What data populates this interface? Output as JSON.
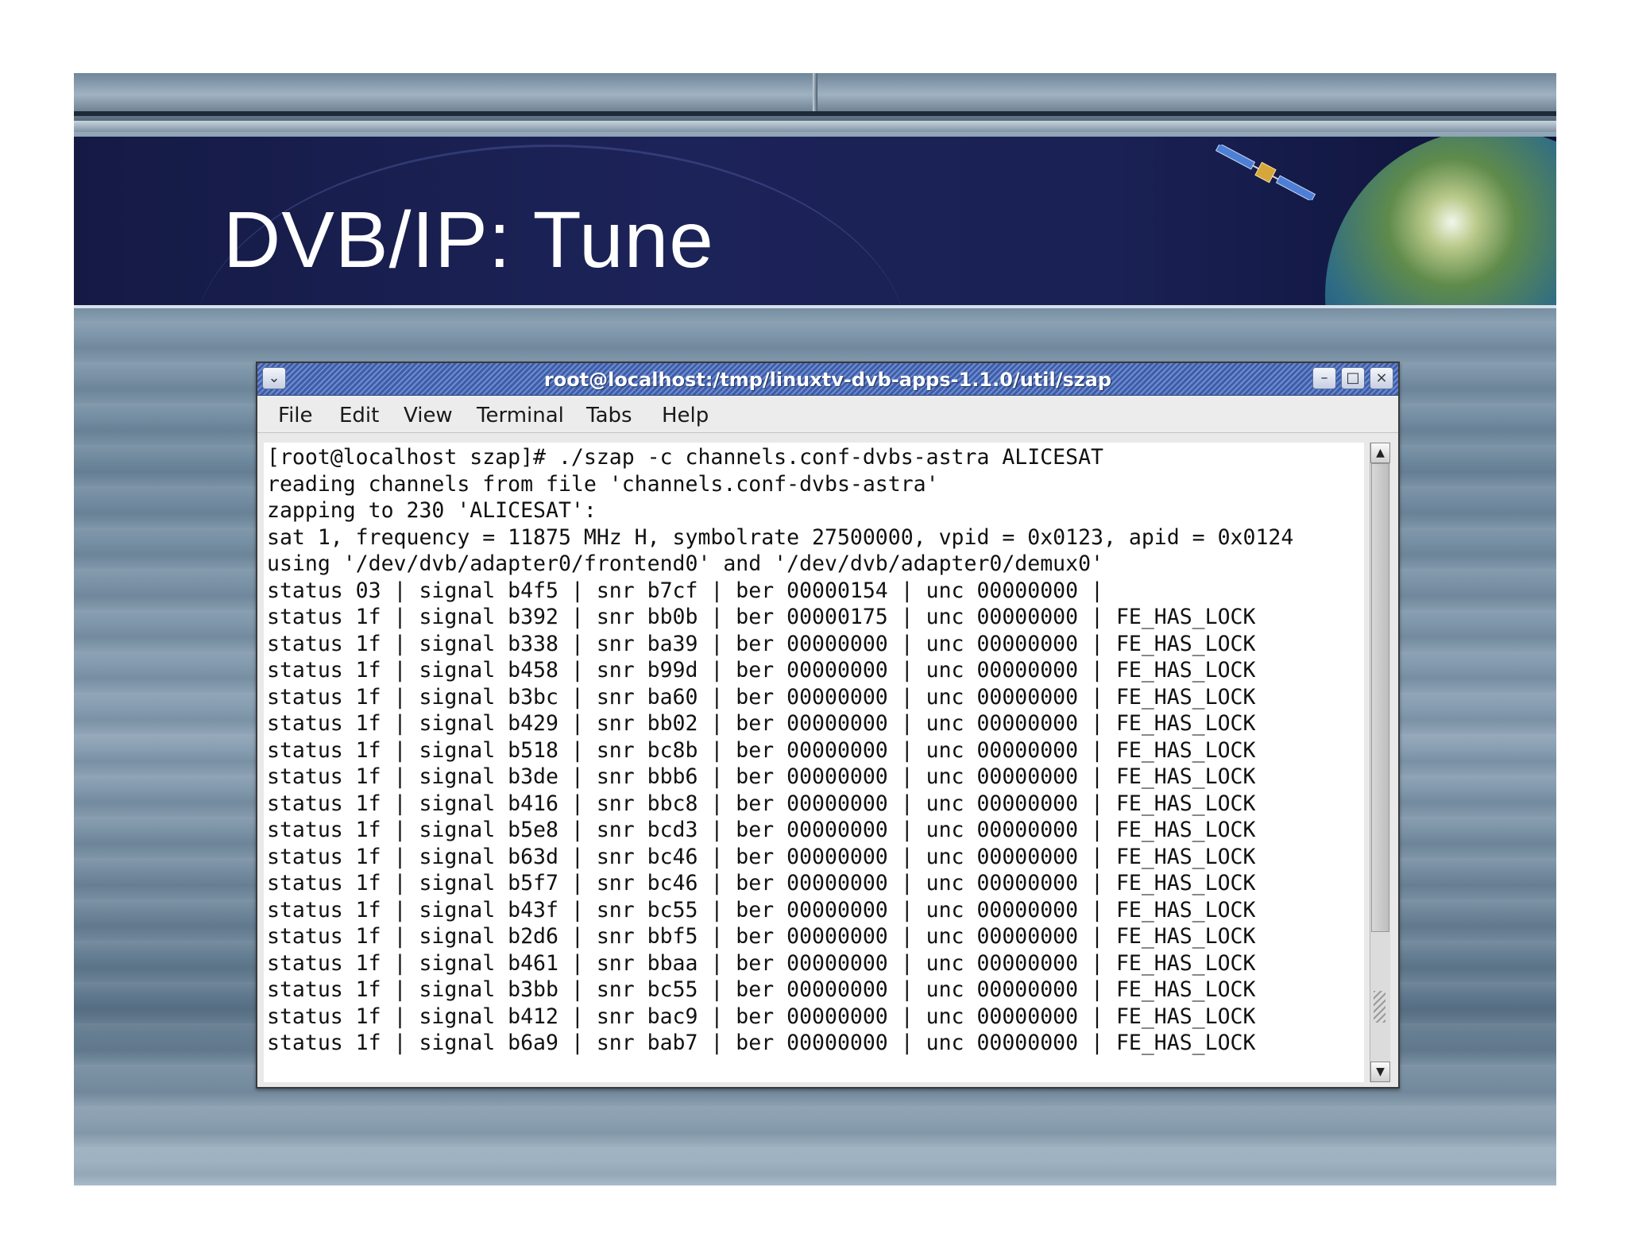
{
  "slide": {
    "title": "DVB/IP: Tune"
  },
  "window": {
    "title": "root@localhost:/tmp/linuxtv-dvb-apps-1.1.0/util/szap",
    "menu": [
      {
        "label": "File"
      },
      {
        "label": "Edit"
      },
      {
        "label": "View"
      },
      {
        "label": "Terminal"
      },
      {
        "label": "Tabs"
      },
      {
        "label": "Help"
      }
    ],
    "buttons": {
      "menu_icon": "chevron-down-icon",
      "minimize_icon": "minimize-icon",
      "maximize_icon": "maximize-icon",
      "close_icon": "close-icon"
    }
  },
  "terminal": {
    "lines": [
      "[root@localhost szap]# ./szap -c channels.conf-dvbs-astra ALICESAT",
      "reading channels from file 'channels.conf-dvbs-astra'",
      "zapping to 230 'ALICESAT':",
      "sat 1, frequency = 11875 MHz H, symbolrate 27500000, vpid = 0x0123, apid = 0x0124",
      "using '/dev/dvb/adapter0/frontend0' and '/dev/dvb/adapter0/demux0'",
      "status 03 | signal b4f5 | snr b7cf | ber 00000154 | unc 00000000 |",
      "status 1f | signal b392 | snr bb0b | ber 00000175 | unc 00000000 | FE_HAS_LOCK",
      "status 1f | signal b338 | snr ba39 | ber 00000000 | unc 00000000 | FE_HAS_LOCK",
      "status 1f | signal b458 | snr b99d | ber 00000000 | unc 00000000 | FE_HAS_LOCK",
      "status 1f | signal b3bc | snr ba60 | ber 00000000 | unc 00000000 | FE_HAS_LOCK",
      "status 1f | signal b429 | snr bb02 | ber 00000000 | unc 00000000 | FE_HAS_LOCK",
      "status 1f | signal b518 | snr bc8b | ber 00000000 | unc 00000000 | FE_HAS_LOCK",
      "status 1f | signal b3de | snr bbb6 | ber 00000000 | unc 00000000 | FE_HAS_LOCK",
      "status 1f | signal b416 | snr bbc8 | ber 00000000 | unc 00000000 | FE_HAS_LOCK",
      "status 1f | signal b5e8 | snr bcd3 | ber 00000000 | unc 00000000 | FE_HAS_LOCK",
      "status 1f | signal b63d | snr bc46 | ber 00000000 | unc 00000000 | FE_HAS_LOCK",
      "status 1f | signal b5f7 | snr bc46 | ber 00000000 | unc 00000000 | FE_HAS_LOCK",
      "status 1f | signal b43f | snr bc55 | ber 00000000 | unc 00000000 | FE_HAS_LOCK",
      "status 1f | signal b2d6 | snr bbf5 | ber 00000000 | unc 00000000 | FE_HAS_LOCK",
      "status 1f | signal b461 | snr bbaa | ber 00000000 | unc 00000000 | FE_HAS_LOCK",
      "status 1f | signal b3bb | snr bc55 | ber 00000000 | unc 00000000 | FE_HAS_LOCK",
      "status 1f | signal b412 | snr bac9 | ber 00000000 | unc 00000000 | FE_HAS_LOCK",
      "status 1f | signal b6a9 | snr bab7 | ber 00000000 | unc 00000000 | FE_HAS_LOCK"
    ]
  },
  "colors": {
    "banner": "#1c2358",
    "titlebar": "#3f5ea8",
    "terminal_bg": "#ffffff",
    "terminal_fg": "#111111"
  }
}
